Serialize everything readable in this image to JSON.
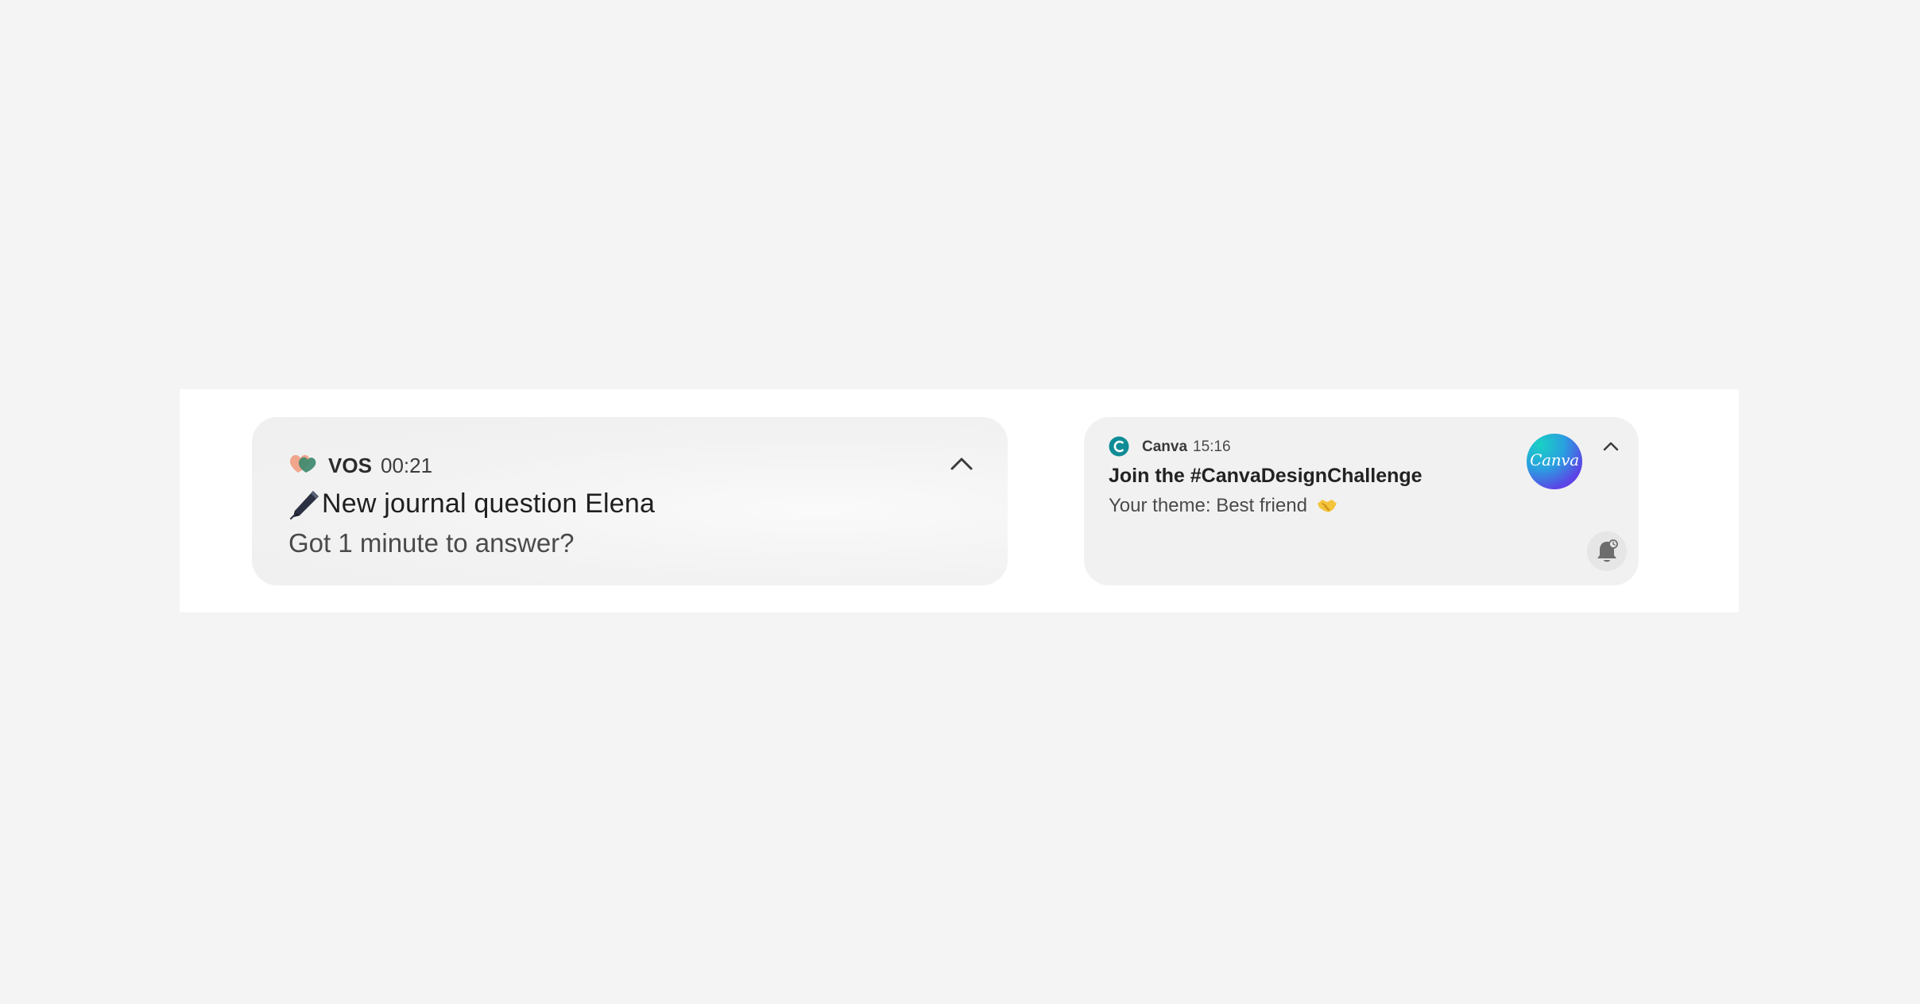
{
  "notifications": [
    {
      "app_name": "VOS",
      "time": "00:21",
      "title_emoji": "pen-icon",
      "title": "New journal question Elena",
      "body": "Got 1 minute to answer?",
      "icon": "vos-hearts-icon",
      "expand_icon": "chevron-up-icon"
    },
    {
      "app_name": "Canva",
      "time": "15:16",
      "title": "Join the #CanvaDesignChallenge",
      "body": "Your theme: Best friend",
      "body_emoji": "handshake-emoji",
      "icon": "canva-small-icon",
      "avatar_text": "Canva",
      "expand_icon": "chevron-up-icon",
      "action_icon": "bell-snooze-icon"
    }
  ],
  "colors": {
    "page_background": "#f4f4f4",
    "stage_background": "#ffffff",
    "card_background": "#f1f1f1",
    "canva_teal": "#0f8c95",
    "canva_gradient_start": "#19d0c4",
    "canva_gradient_end": "#7a2ee6"
  }
}
